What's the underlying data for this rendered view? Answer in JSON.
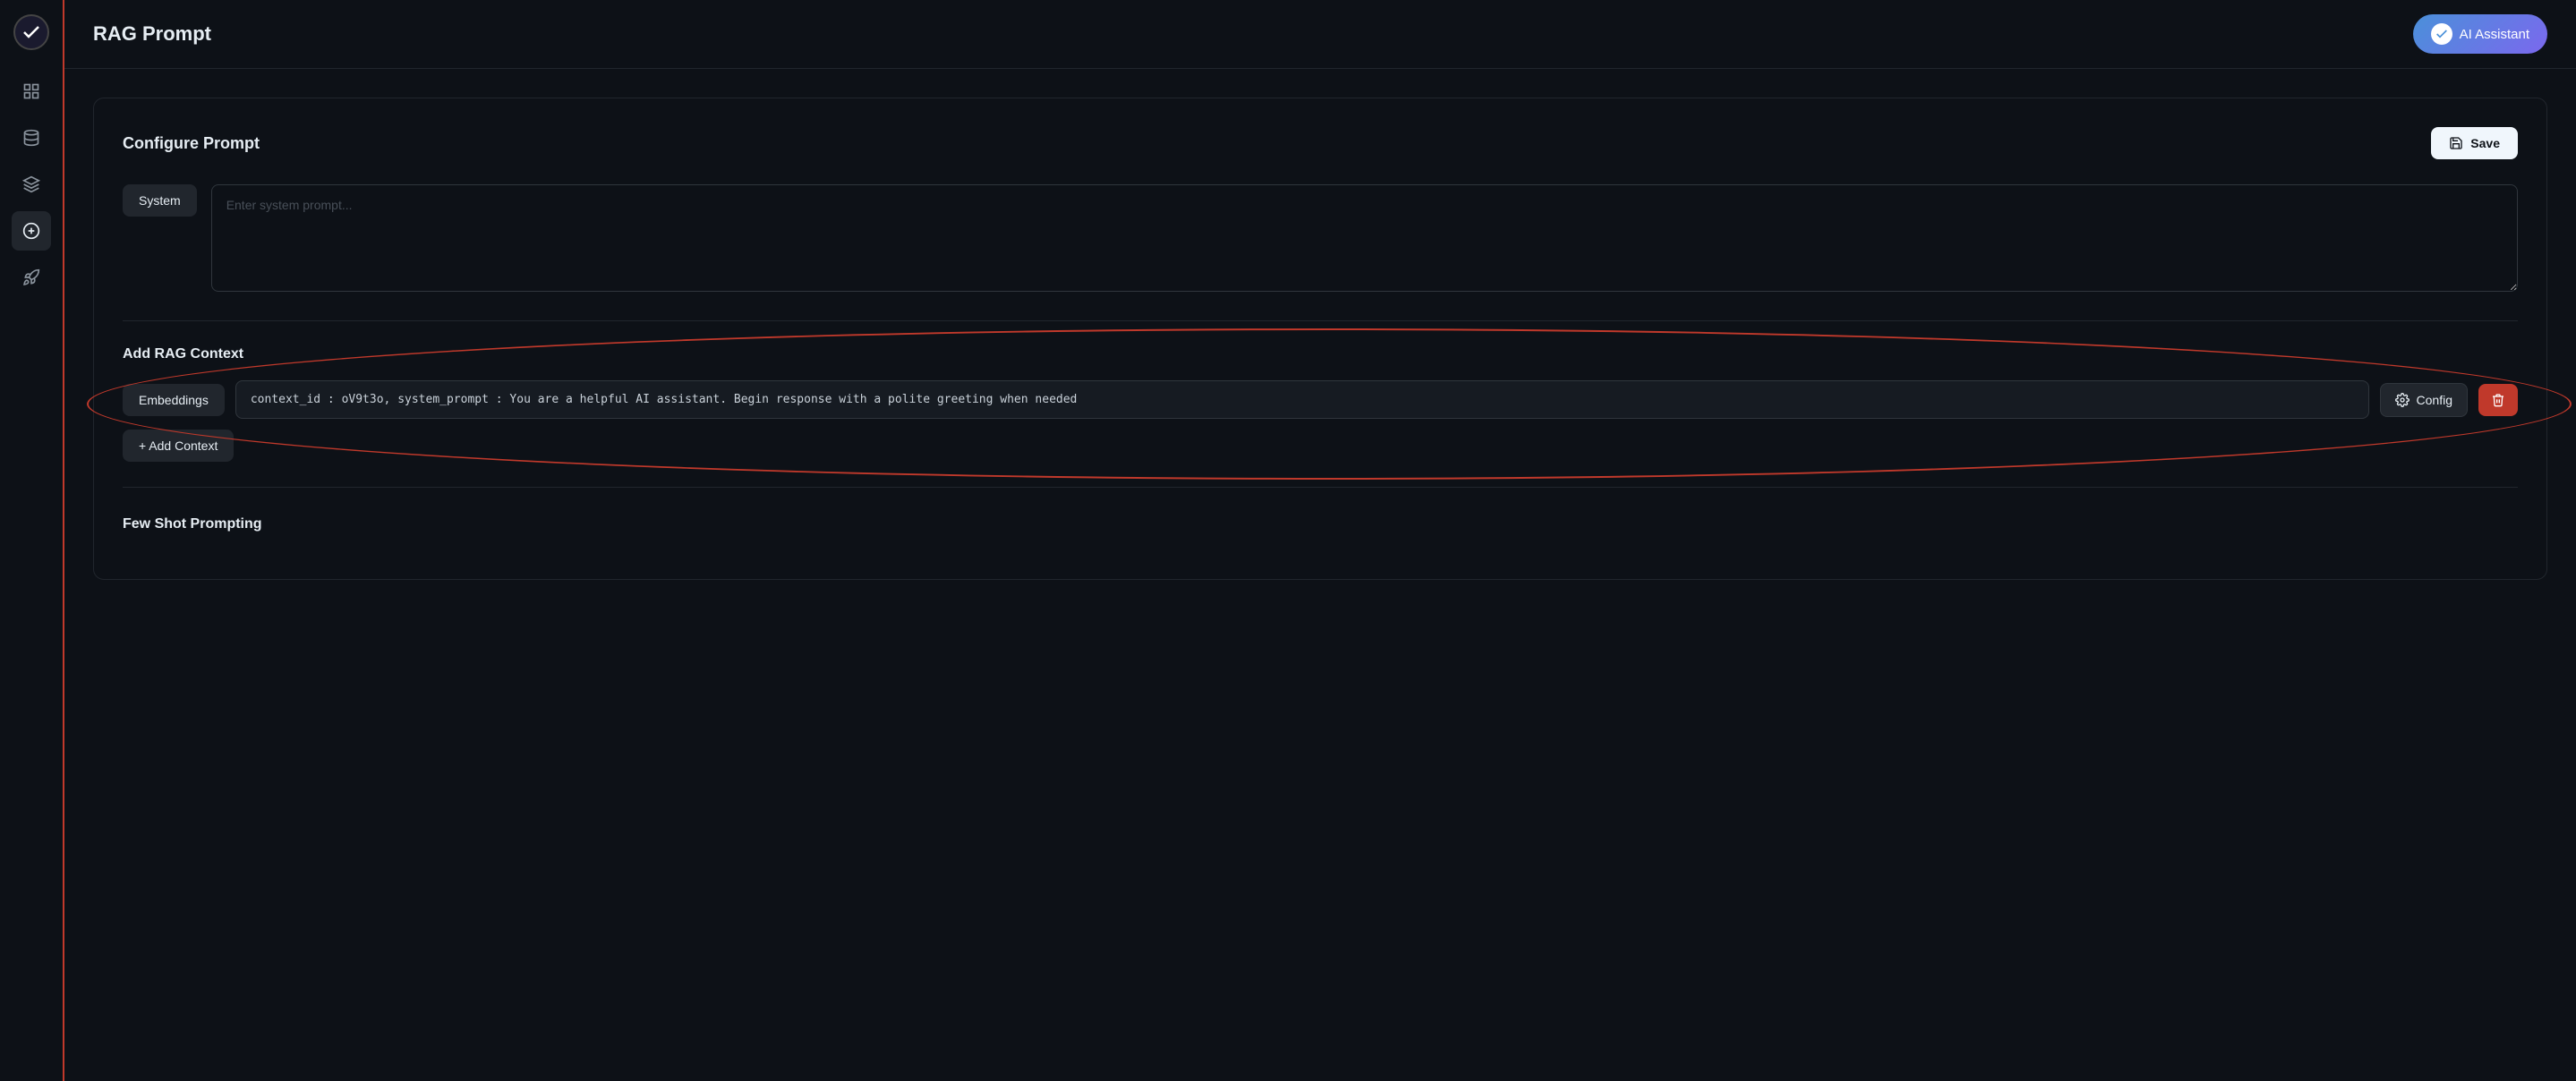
{
  "sidebar": {
    "logo": "checkmark",
    "items": [
      {
        "id": "dashboard",
        "icon": "grid",
        "label": "Dashboard",
        "active": false
      },
      {
        "id": "database",
        "icon": "database",
        "label": "Database",
        "active": false
      },
      {
        "id": "layers",
        "icon": "layers",
        "label": "Layers",
        "active": false
      },
      {
        "id": "add-context",
        "icon": "add-context",
        "label": "Add Context",
        "active": false
      },
      {
        "id": "rocket",
        "icon": "rocket",
        "label": "Deploy",
        "active": false
      }
    ]
  },
  "header": {
    "title": "RAG Prompt",
    "ai_assistant_label": "AI Assistant"
  },
  "configure_prompt": {
    "title": "Configure Prompt",
    "save_label": "Save",
    "system": {
      "role_label": "System",
      "placeholder": "Enter system prompt..."
    }
  },
  "rag_context": {
    "title": "Add RAG Context",
    "embeddings_label": "Embeddings",
    "context_value": "context_id : oV9t3o,  system_prompt : You are a helpful AI assistant. Begin response with a polite greeting when needed",
    "config_label": "Config",
    "add_context_label": "+ Add Context"
  },
  "few_shot": {
    "title": "Few Shot Prompting"
  }
}
